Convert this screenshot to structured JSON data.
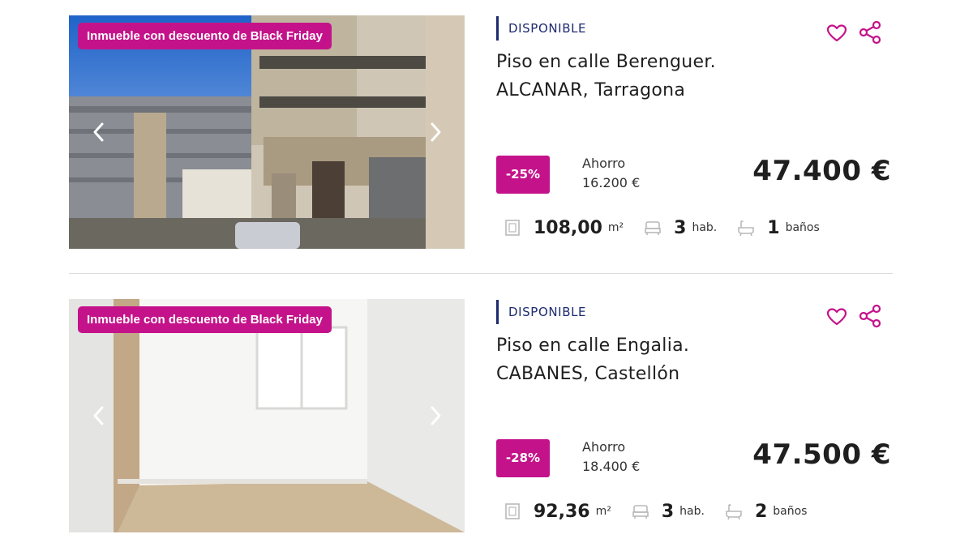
{
  "listings": [
    {
      "badge": "Inmueble con descuento de Black Friday",
      "status": "DISPONIBLE",
      "title_line1": "Piso en calle Berenguer.",
      "title_line2": "ALCANAR, Tarragona",
      "discount": "-25%",
      "saving_label": "Ahorro",
      "saving_value": "16.200 €",
      "price": "47.400 €",
      "area_value": "108,00",
      "area_unit": "m²",
      "rooms_value": "3",
      "rooms_unit": "hab.",
      "baths_value": "1",
      "baths_unit": "baños",
      "photo_icon": "street-building-photo"
    },
    {
      "badge": "Inmueble con descuento de Black Friday",
      "status": "DISPONIBLE",
      "title_line1": "Piso en calle Engalia.",
      "title_line2": "CABANES, Castellón",
      "discount": "-28%",
      "saving_label": "Ahorro",
      "saving_value": "18.400 €",
      "price": "47.500 €",
      "area_value": "92,36",
      "area_unit": "m²",
      "rooms_value": "3",
      "rooms_unit": "hab.",
      "baths_value": "2",
      "baths_unit": "baños",
      "photo_icon": "empty-room-photo"
    }
  ],
  "colors": {
    "brand": "#c4138a",
    "status": "#1c2a6e",
    "text": "#1f1f1f",
    "divider": "#dcdcdc"
  },
  "icons": {
    "favorite": "heart-icon",
    "share": "share-icon",
    "prev": "chevron-left-icon",
    "next": "chevron-right-icon",
    "area": "area-icon",
    "rooms": "bed-icon",
    "baths": "bathtub-icon"
  }
}
